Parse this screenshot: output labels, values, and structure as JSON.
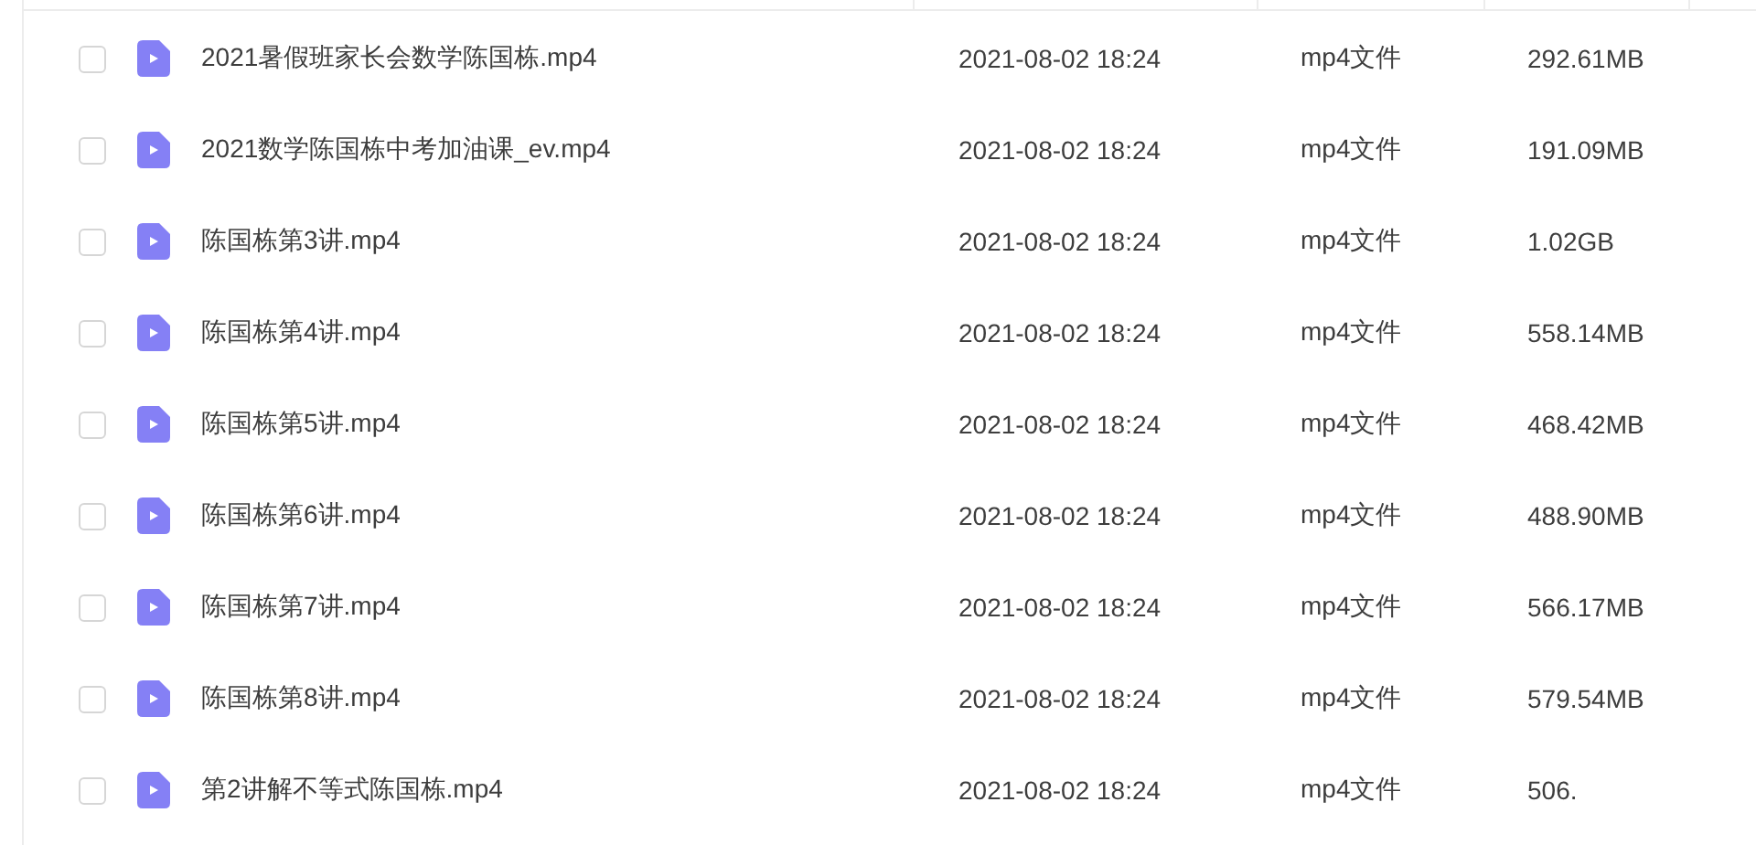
{
  "files": [
    {
      "name": "2021暑假班家长会数学陈国栋.mp4",
      "date": "2021-08-02 18:24",
      "type": "mp4文件",
      "size": "292.61MB",
      "checked": false
    },
    {
      "name": "2021数学陈国栋中考加油课_ev.mp4",
      "date": "2021-08-02 18:24",
      "type": "mp4文件",
      "size": "191.09MB",
      "checked": false
    },
    {
      "name": "陈国栋第3讲.mp4",
      "date": "2021-08-02 18:24",
      "type": "mp4文件",
      "size": "1.02GB",
      "checked": false
    },
    {
      "name": "陈国栋第4讲.mp4",
      "date": "2021-08-02 18:24",
      "type": "mp4文件",
      "size": "558.14MB",
      "checked": false
    },
    {
      "name": "陈国栋第5讲.mp4",
      "date": "2021-08-02 18:24",
      "type": "mp4文件",
      "size": "468.42MB",
      "checked": false
    },
    {
      "name": "陈国栋第6讲.mp4",
      "date": "2021-08-02 18:24",
      "type": "mp4文件",
      "size": "488.90MB",
      "checked": false
    },
    {
      "name": "陈国栋第7讲.mp4",
      "date": "2021-08-02 18:24",
      "type": "mp4文件",
      "size": "566.17MB",
      "checked": false
    },
    {
      "name": "陈国栋第8讲.mp4",
      "date": "2021-08-02 18:24",
      "type": "mp4文件",
      "size": "579.54MB",
      "checked": false
    },
    {
      "name": "第2讲解不等式陈国栋.mp4",
      "date": "2021-08-02 18:24",
      "type": "mp4文件",
      "size": "506.",
      "checked": false
    }
  ]
}
